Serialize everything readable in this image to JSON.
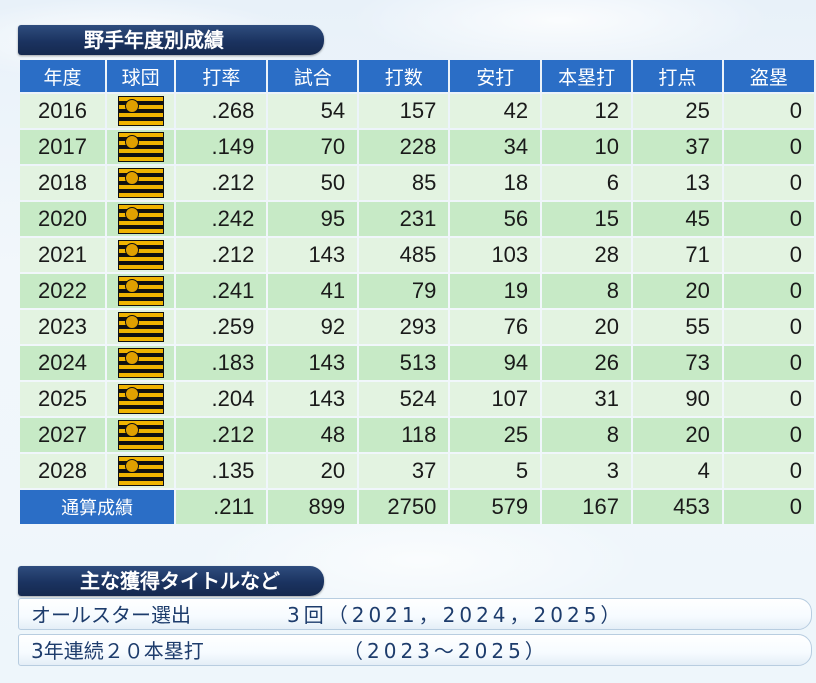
{
  "stats_section": {
    "title": "野手年度別成績",
    "columns": [
      "年度",
      "球団",
      "打率",
      "試合",
      "打数",
      "安打",
      "本塁打",
      "打点",
      "盗塁"
    ],
    "rows": [
      {
        "year": "2016",
        "avg": ".268",
        "games": "54",
        "at_bats": "157",
        "hits": "42",
        "home_runs": "12",
        "rbi": "25",
        "steals": "0"
      },
      {
        "year": "2017",
        "avg": ".149",
        "games": "70",
        "at_bats": "228",
        "hits": "34",
        "home_runs": "10",
        "rbi": "37",
        "steals": "0"
      },
      {
        "year": "2018",
        "avg": ".212",
        "games": "50",
        "at_bats": "85",
        "hits": "18",
        "home_runs": "6",
        "rbi": "13",
        "steals": "0"
      },
      {
        "year": "2020",
        "avg": ".242",
        "games": "95",
        "at_bats": "231",
        "hits": "56",
        "home_runs": "15",
        "rbi": "45",
        "steals": "0"
      },
      {
        "year": "2021",
        "avg": ".212",
        "games": "143",
        "at_bats": "485",
        "hits": "103",
        "home_runs": "28",
        "rbi": "71",
        "steals": "0"
      },
      {
        "year": "2022",
        "avg": ".241",
        "games": "41",
        "at_bats": "79",
        "hits": "19",
        "home_runs": "8",
        "rbi": "20",
        "steals": "0"
      },
      {
        "year": "2023",
        "avg": ".259",
        "games": "92",
        "at_bats": "293",
        "hits": "76",
        "home_runs": "20",
        "rbi": "55",
        "steals": "0"
      },
      {
        "year": "2024",
        "avg": ".183",
        "games": "143",
        "at_bats": "513",
        "hits": "94",
        "home_runs": "26",
        "rbi": "73",
        "steals": "0"
      },
      {
        "year": "2025",
        "avg": ".204",
        "games": "143",
        "at_bats": "524",
        "hits": "107",
        "home_runs": "31",
        "rbi": "90",
        "steals": "0"
      },
      {
        "year": "2027",
        "avg": ".212",
        "games": "48",
        "at_bats": "118",
        "hits": "25",
        "home_runs": "8",
        "rbi": "20",
        "steals": "0"
      },
      {
        "year": "2028",
        "avg": ".135",
        "games": "20",
        "at_bats": "37",
        "hits": "5",
        "home_runs": "3",
        "rbi": "4",
        "steals": "0"
      }
    ],
    "totals": {
      "label": "通算成績",
      "avg": ".211",
      "games": "899",
      "at_bats": "2750",
      "hits": "579",
      "home_runs": "167",
      "rbi": "453",
      "steals": "0"
    },
    "team_icon": "tigers-logo-icon"
  },
  "titles_section": {
    "title": "主な獲得タイトルなど",
    "items": [
      {
        "name": "オールスター選出",
        "detail": "3回（2021，2024，2025）"
      },
      {
        "name": "3年連続２０本塁打",
        "detail": "（2023～2025）"
      }
    ]
  },
  "colors": {
    "header_bg": "#1b3360",
    "column_header_bg": "#2b6ec6",
    "row_light": "#e3f3e1",
    "row_dark": "#c7eac6",
    "title_text": "#1d3c6c"
  }
}
